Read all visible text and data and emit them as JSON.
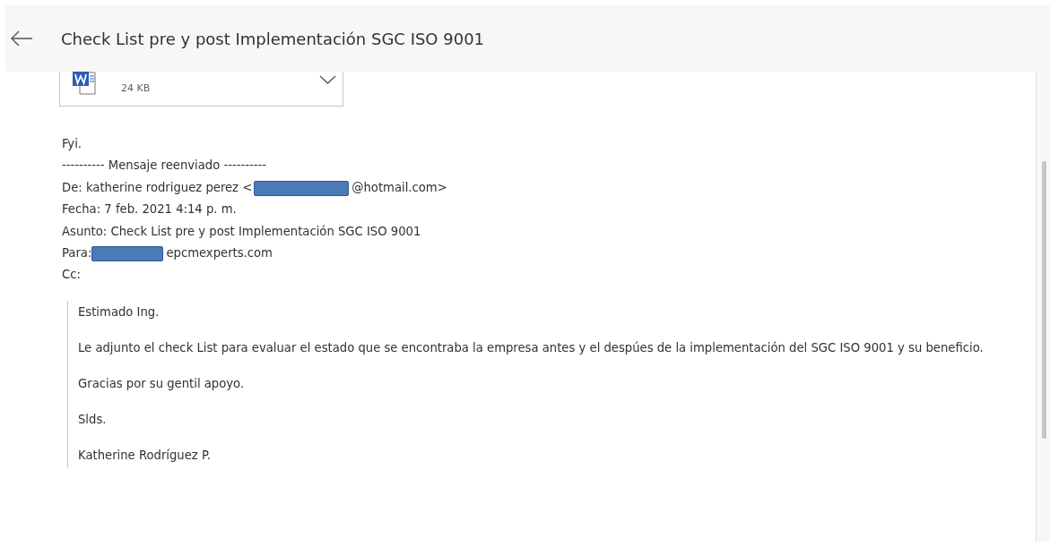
{
  "header": {
    "title": "Check List pre y post Implementación SGC ISO 9001"
  },
  "attachment": {
    "size": "24 KB"
  },
  "body": {
    "greeting": "Fyi.",
    "separator": "---------- Mensaje reenviado ----------",
    "from": {
      "before": "De: katherine rodriguez perez <",
      "after": "@hotmail.com>"
    },
    "date": "Fecha: 7 feb. 2021 4:14 p. m.",
    "subject": "Asunto: Check List pre y post Implementación SGC ISO 9001",
    "to": {
      "before": "Para:",
      "after": "epcmexperts.com"
    },
    "cc": "Cc:"
  },
  "quote": [
    "Estimado Ing.",
    "Le adjunto el check List para evaluar el estado que se encontraba la empresa antes y el despúes de la implementación del SGC ISO 9001 y su beneficio.",
    "Gracias por su gentil apoyo.",
    "Slds.",
    "Katherine Rodríguez P."
  ]
}
